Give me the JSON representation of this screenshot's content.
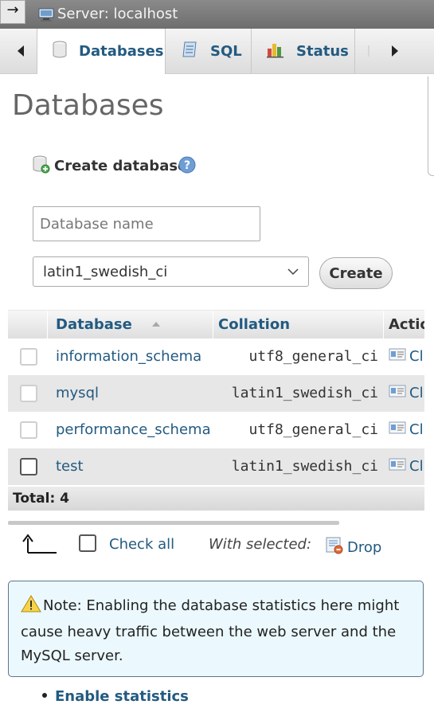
{
  "header": {
    "collapse_glyph": "→",
    "breadcrumb": "Server: localhost"
  },
  "tabs": [
    {
      "label": "Databases",
      "icon": "database-icon",
      "active": true
    },
    {
      "label": "SQL",
      "icon": "sql-icon",
      "active": false
    },
    {
      "label": "Status",
      "icon": "status-chart-icon",
      "active": false
    }
  ],
  "page": {
    "title": "Databases"
  },
  "create_database": {
    "heading": "Create database",
    "name_placeholder": "Database name",
    "name_value": "",
    "collation_selected": "latin1_swedish_ci",
    "create_button": "Create"
  },
  "table": {
    "headers": {
      "database": "Database",
      "collation": "Collation",
      "action": "Actio"
    },
    "sort_indicator": "ascending",
    "rows": [
      {
        "name": "information_schema",
        "collation": "utf8_general_ci",
        "action": "Cl"
      },
      {
        "name": "mysql",
        "collation": "latin1_swedish_ci",
        "action": "Cl"
      },
      {
        "name": "performance_schema",
        "collation": "utf8_general_ci",
        "action": "Cl"
      },
      {
        "name": "test",
        "collation": "latin1_swedish_ci",
        "action": "Cl"
      }
    ],
    "total": "Total: 4"
  },
  "bulk": {
    "check_all": "Check all",
    "with_selected": "With selected:",
    "drop": "Drop"
  },
  "notice": {
    "text": "Note: Enabling the database statistics here might cause heavy traffic between the web server and the MySQL server."
  },
  "links": {
    "enable_statistics": "Enable statistics"
  },
  "colors": {
    "link": "#235a81",
    "notice_bg": "#ebf8fd",
    "row_alt": "#e7e7e7"
  }
}
